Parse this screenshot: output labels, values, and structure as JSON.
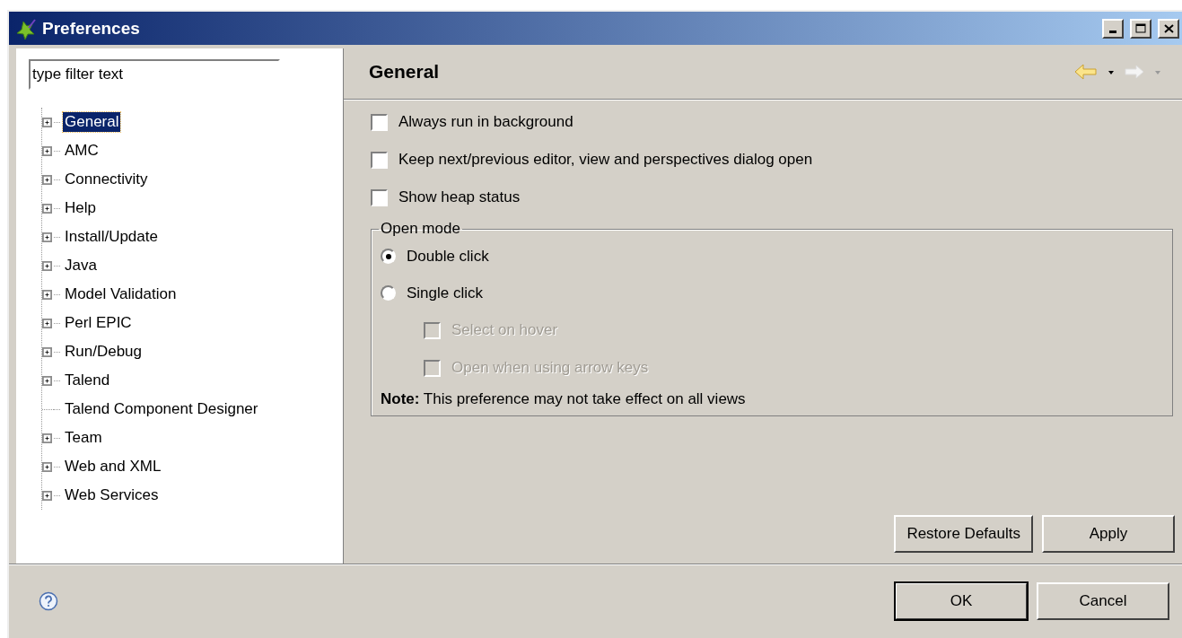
{
  "window": {
    "title": "Preferences"
  },
  "filter": {
    "placeholder": "type filter text"
  },
  "tree": [
    {
      "label": "General",
      "expandable": true,
      "selected": true
    },
    {
      "label": "AMC",
      "expandable": true,
      "selected": false
    },
    {
      "label": "Connectivity",
      "expandable": true,
      "selected": false
    },
    {
      "label": "Help",
      "expandable": true,
      "selected": false
    },
    {
      "label": "Install/Update",
      "expandable": true,
      "selected": false
    },
    {
      "label": "Java",
      "expandable": true,
      "selected": false
    },
    {
      "label": "Model Validation",
      "expandable": true,
      "selected": false
    },
    {
      "label": "Perl EPIC",
      "expandable": true,
      "selected": false
    },
    {
      "label": "Run/Debug",
      "expandable": true,
      "selected": false
    },
    {
      "label": "Talend",
      "expandable": true,
      "selected": false
    },
    {
      "label": "Talend Component Designer",
      "expandable": false,
      "selected": false
    },
    {
      "label": "Team",
      "expandable": true,
      "selected": false
    },
    {
      "label": "Web and XML",
      "expandable": true,
      "selected": false
    },
    {
      "label": "Web Services",
      "expandable": true,
      "selected": false
    }
  ],
  "page": {
    "title": "General",
    "options": [
      {
        "label": "Always run in background",
        "checked": false
      },
      {
        "label": "Keep next/previous editor, view and perspectives dialog open",
        "checked": false
      },
      {
        "label": "Show heap status",
        "checked": false
      }
    ],
    "open_mode": {
      "title": "Open mode",
      "radios": [
        {
          "label": "Double click",
          "selected": true
        },
        {
          "label": "Single click",
          "selected": false
        }
      ],
      "sub_options": [
        {
          "label": "Select on hover",
          "checked": false,
          "disabled": true
        },
        {
          "label": "Open when using arrow keys",
          "checked": false,
          "disabled": true
        }
      ],
      "note": "**Note:** This preference may not take effect on all views"
    },
    "buttons": [
      {
        "label": "Restore Defaults",
        "default": false
      },
      {
        "label": "Apply",
        "default": false
      }
    ]
  },
  "footer_buttons": [
    {
      "label": "OK",
      "default": true
    },
    {
      "label": "Cancel",
      "default": false
    }
  ]
}
